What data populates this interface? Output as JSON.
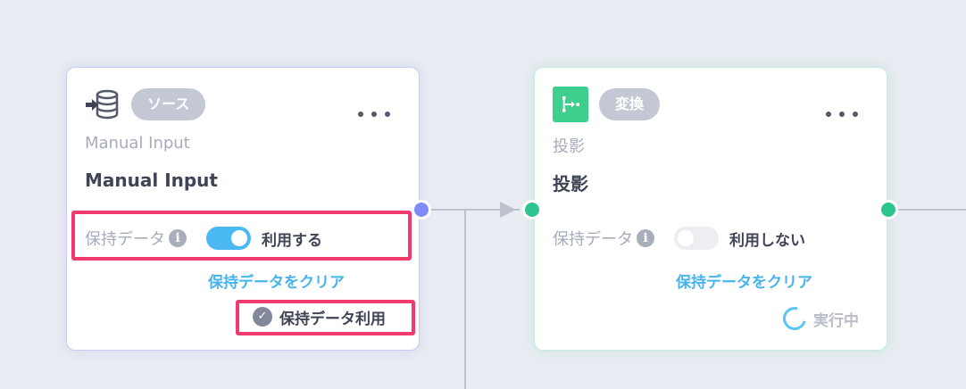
{
  "nodes": [
    {
      "badge": "ソース",
      "subtitle": "Manual Input",
      "title": "Manual Input",
      "keep_label": "保持データ",
      "toggle_state": "on",
      "toggle_text": "利用する",
      "clear_link": "保持データをクリア",
      "use_cache_text": "保持データ利用",
      "icon": "database-import-icon",
      "border_color": "#c9cdf5"
    },
    {
      "badge": "変換",
      "subtitle": "投影",
      "title": "投影",
      "keep_label": "保持データ",
      "toggle_state": "off",
      "toggle_text": "利用しない",
      "clear_link": "保持データをクリア",
      "status_text": "実行中",
      "icon": "transform-icon",
      "accent_color": "#3ecf8e",
      "border_color": "#c6ecdb"
    }
  ],
  "colors": {
    "background": "#e9ecf2",
    "highlight": "#f23a6e",
    "toggle_on": "#4ab8f2",
    "link": "#48b4ee",
    "port_output_source": "#7d8cf6",
    "port_transform": "#2ec48d"
  }
}
